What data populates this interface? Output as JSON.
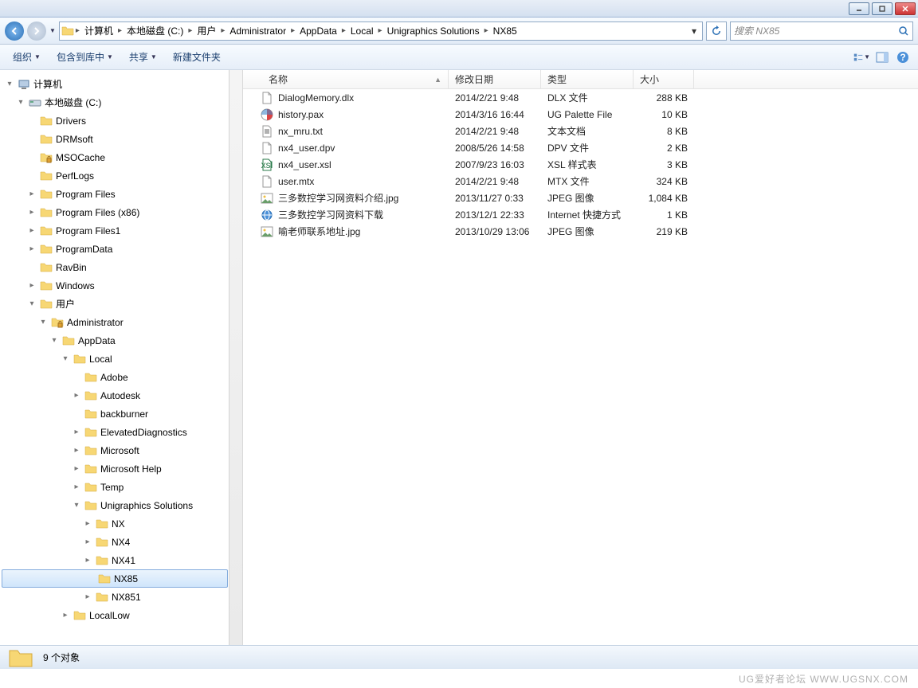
{
  "breadcrumbs": [
    "计算机",
    "本地磁盘 (C:)",
    "用户",
    "Administrator",
    "AppData",
    "Local",
    "Unigraphics Solutions",
    "NX85"
  ],
  "search_placeholder": "搜索 NX85",
  "toolbar": {
    "organize": "组织",
    "include": "包含到库中",
    "share": "共享",
    "newfolder": "新建文件夹"
  },
  "columns": {
    "name": "名称",
    "date": "修改日期",
    "type": "类型",
    "size": "大小"
  },
  "tree": [
    {
      "label": "计算机",
      "indent": 0,
      "icon": "computer",
      "exp": "▾"
    },
    {
      "label": "本地磁盘 (C:)",
      "indent": 1,
      "icon": "drive",
      "exp": "▾"
    },
    {
      "label": "Drivers",
      "indent": 2,
      "icon": "folder",
      "exp": ""
    },
    {
      "label": "DRMsoft",
      "indent": 2,
      "icon": "folder",
      "exp": ""
    },
    {
      "label": "MSOCache",
      "indent": 2,
      "icon": "folder-lock",
      "exp": ""
    },
    {
      "label": "PerfLogs",
      "indent": 2,
      "icon": "folder",
      "exp": ""
    },
    {
      "label": "Program Files",
      "indent": 2,
      "icon": "folder",
      "exp": "▸"
    },
    {
      "label": "Program Files (x86)",
      "indent": 2,
      "icon": "folder",
      "exp": "▸"
    },
    {
      "label": "Program Files1",
      "indent": 2,
      "icon": "folder",
      "exp": "▸"
    },
    {
      "label": "ProgramData",
      "indent": 2,
      "icon": "folder",
      "exp": "▸"
    },
    {
      "label": "RavBin",
      "indent": 2,
      "icon": "folder",
      "exp": ""
    },
    {
      "label": "Windows",
      "indent": 2,
      "icon": "folder",
      "exp": "▸"
    },
    {
      "label": "用户",
      "indent": 2,
      "icon": "folder",
      "exp": "▾"
    },
    {
      "label": "Administrator",
      "indent": 3,
      "icon": "folder-lock",
      "exp": "▾"
    },
    {
      "label": "AppData",
      "indent": 4,
      "icon": "folder",
      "exp": "▾"
    },
    {
      "label": "Local",
      "indent": 5,
      "icon": "folder",
      "exp": "▾"
    },
    {
      "label": "Adobe",
      "indent": 6,
      "icon": "folder",
      "exp": ""
    },
    {
      "label": "Autodesk",
      "indent": 6,
      "icon": "folder",
      "exp": "▸"
    },
    {
      "label": "backburner",
      "indent": 6,
      "icon": "folder",
      "exp": ""
    },
    {
      "label": "ElevatedDiagnostics",
      "indent": 6,
      "icon": "folder",
      "exp": "▸"
    },
    {
      "label": "Microsoft",
      "indent": 6,
      "icon": "folder",
      "exp": "▸"
    },
    {
      "label": "Microsoft Help",
      "indent": 6,
      "icon": "folder",
      "exp": "▸"
    },
    {
      "label": "Temp",
      "indent": 6,
      "icon": "folder",
      "exp": "▸"
    },
    {
      "label": "Unigraphics Solutions",
      "indent": 6,
      "icon": "folder",
      "exp": "▾"
    },
    {
      "label": "NX",
      "indent": 7,
      "icon": "folder",
      "exp": "▸"
    },
    {
      "label": "NX4",
      "indent": 7,
      "icon": "folder",
      "exp": "▸"
    },
    {
      "label": "NX41",
      "indent": 7,
      "icon": "folder",
      "exp": "▸"
    },
    {
      "label": "NX85",
      "indent": 7,
      "icon": "folder",
      "exp": "",
      "selected": true
    },
    {
      "label": "NX851",
      "indent": 7,
      "icon": "folder",
      "exp": "▸"
    },
    {
      "label": "LocalLow",
      "indent": 5,
      "icon": "folder",
      "exp": "▸"
    }
  ],
  "files": [
    {
      "name": "DialogMemory.dlx",
      "date": "2014/2/21 9:48",
      "type": "DLX 文件",
      "size": "288 KB",
      "icon": "file"
    },
    {
      "name": "history.pax",
      "date": "2014/3/16 16:44",
      "type": "UG Palette File",
      "size": "10 KB",
      "icon": "pax"
    },
    {
      "name": "nx_mru.txt",
      "date": "2014/2/21 9:48",
      "type": "文本文档",
      "size": "8 KB",
      "icon": "txt"
    },
    {
      "name": "nx4_user.dpv",
      "date": "2008/5/26 14:58",
      "type": "DPV 文件",
      "size": "2 KB",
      "icon": "file"
    },
    {
      "name": "nx4_user.xsl",
      "date": "2007/9/23 16:03",
      "type": "XSL 样式表",
      "size": "3 KB",
      "icon": "xsl"
    },
    {
      "name": "user.mtx",
      "date": "2014/2/21 9:48",
      "type": "MTX 文件",
      "size": "324 KB",
      "icon": "file"
    },
    {
      "name": "三多数控学习网资料介绍.jpg",
      "date": "2013/11/27 0:33",
      "type": "JPEG 图像",
      "size": "1,084 KB",
      "icon": "jpg"
    },
    {
      "name": "三多数控学习网资料下载",
      "date": "2013/12/1 22:33",
      "type": "Internet 快捷方式",
      "size": "1 KB",
      "icon": "url"
    },
    {
      "name": "喻老师联系地址.jpg",
      "date": "2013/10/29 13:06",
      "type": "JPEG 图像",
      "size": "219 KB",
      "icon": "jpg"
    }
  ],
  "status": "9 个对象",
  "watermark": "UG爱好者论坛  WWW.UGSNX.COM"
}
